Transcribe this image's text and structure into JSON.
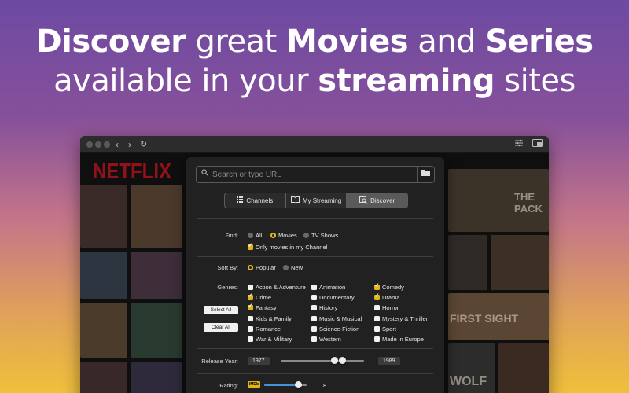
{
  "headline": {
    "line1": [
      {
        "text": "Discover",
        "bold": true
      },
      {
        "text": " great ",
        "bold": false
      },
      {
        "text": "Movies",
        "bold": true
      },
      {
        "text": " and ",
        "bold": false
      },
      {
        "text": "Series",
        "bold": true
      }
    ],
    "line2": [
      {
        "text": "available in your ",
        "bold": false
      },
      {
        "text": "streaming",
        "bold": true
      },
      {
        "text": " sites",
        "bold": false
      }
    ]
  },
  "window": {
    "background_logo": "NETFLIX",
    "background_texts": [
      "FIRST SIGHT",
      "THE PACK",
      "WOLF"
    ]
  },
  "urlbar": {
    "placeholder": "Search or type URL"
  },
  "tabs": [
    {
      "label": "Channels",
      "icon": "grid-icon",
      "selected": false
    },
    {
      "label": "My Streaming",
      "icon": "book-icon",
      "selected": false
    },
    {
      "label": "Discover",
      "icon": "discover-icon",
      "selected": true
    }
  ],
  "find": {
    "label": "Find:",
    "options": [
      {
        "label": "All",
        "selected": false
      },
      {
        "label": "Movies",
        "selected": true
      },
      {
        "label": "TV Shows",
        "selected": false
      }
    ],
    "only_channel": {
      "label": "Only movies in my Channel",
      "checked": true
    }
  },
  "sort": {
    "label": "Sort By:",
    "options": [
      {
        "label": "Popular",
        "selected": true
      },
      {
        "label": "New",
        "selected": false
      }
    ]
  },
  "genres": {
    "label": "Genres:",
    "select_all": "Select All",
    "clear_all": "Clear All",
    "items": [
      {
        "label": "Action & Adventure",
        "checked": false
      },
      {
        "label": "Animation",
        "checked": false
      },
      {
        "label": "Comedy",
        "checked": true
      },
      {
        "label": "Crime",
        "checked": true
      },
      {
        "label": "Documentary",
        "checked": false
      },
      {
        "label": "Drama",
        "checked": true
      },
      {
        "label": "Fantasy",
        "checked": true
      },
      {
        "label": "History",
        "checked": false
      },
      {
        "label": "Horror",
        "checked": false
      },
      {
        "label": "Kids & Family",
        "checked": false
      },
      {
        "label": "Music & Musical",
        "checked": false
      },
      {
        "label": "Mystery & Thriller",
        "checked": false
      },
      {
        "label": "Romance",
        "checked": false
      },
      {
        "label": "Science-Fiction",
        "checked": false
      },
      {
        "label": "Sport",
        "checked": false
      },
      {
        "label": "War & Military",
        "checked": false
      },
      {
        "label": "Western",
        "checked": false
      },
      {
        "label": "Made in Europe",
        "checked": false
      }
    ]
  },
  "release_year": {
    "label": "Release Year:",
    "min": "1977",
    "max": "1989"
  },
  "rating": {
    "label": "Rating:",
    "badge": "IMDb",
    "value": "8",
    "level": 0.8
  },
  "colors": {
    "accent": "#e2b31c",
    "slider_fill": "#4a90d9"
  }
}
